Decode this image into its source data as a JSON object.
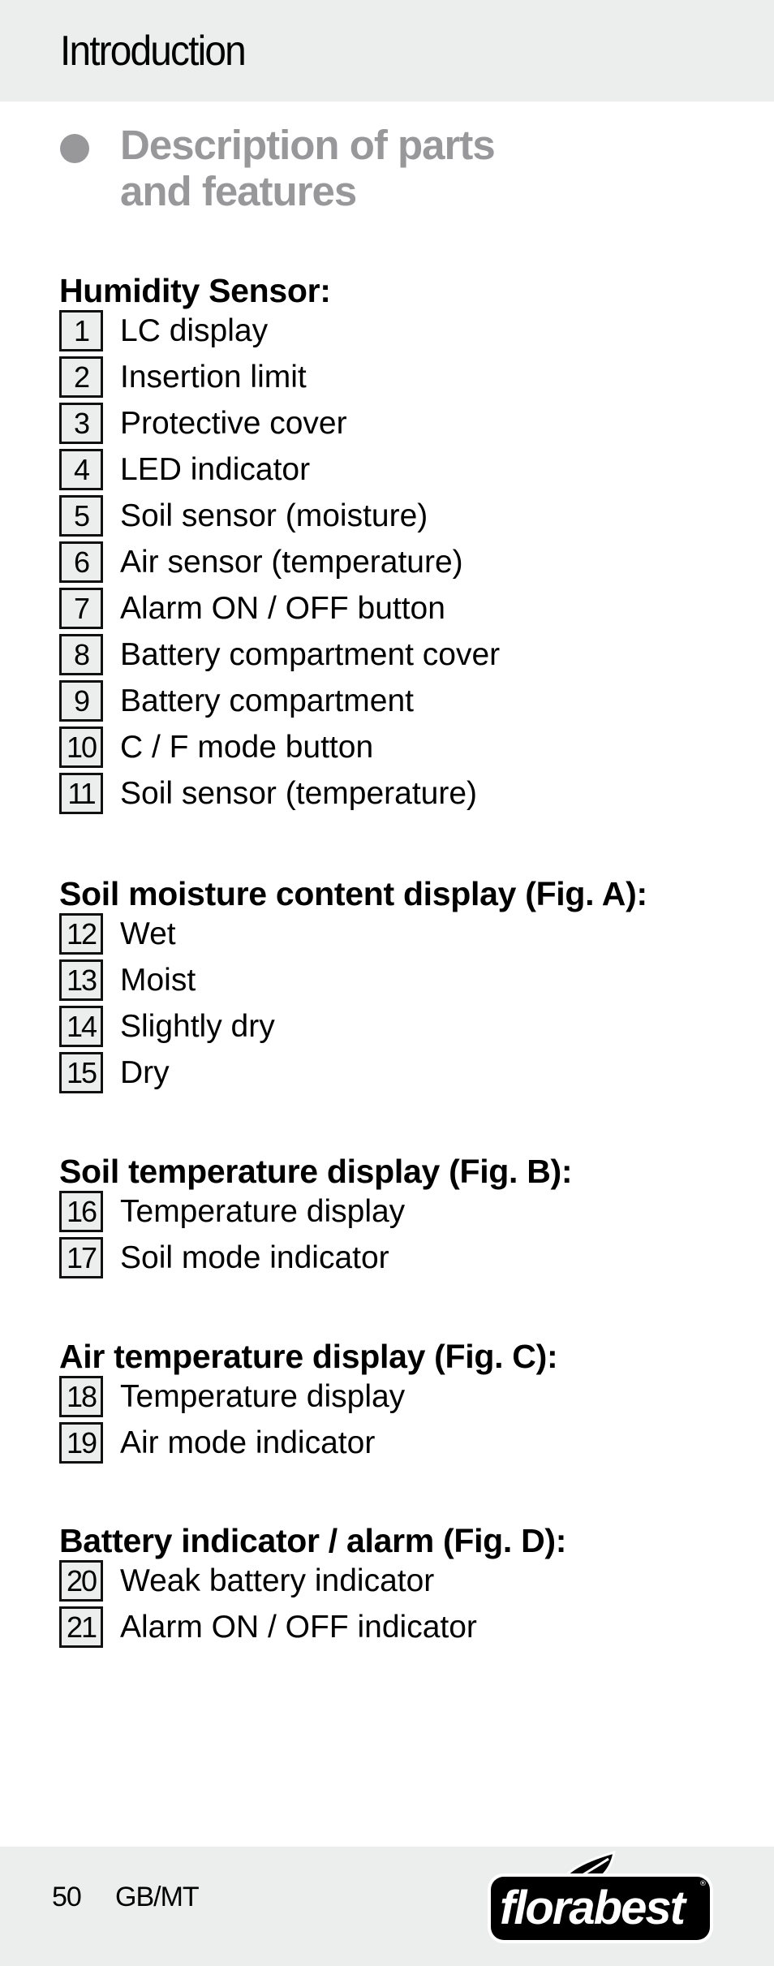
{
  "header": {
    "title": "Introduction"
  },
  "section": {
    "title_line1": "Description of parts",
    "title_line2": "and features"
  },
  "groups": [
    {
      "title": "Humidity Sensor:",
      "items": [
        {
          "num": "1",
          "label": "LC display"
        },
        {
          "num": "2",
          "label": "Insertion limit"
        },
        {
          "num": "3",
          "label": "Protective cover"
        },
        {
          "num": "4",
          "label": "LED indicator"
        },
        {
          "num": "5",
          "label": "Soil sensor (moisture)"
        },
        {
          "num": "6",
          "label": "Air sensor (temperature)"
        },
        {
          "num": "7",
          "label": "Alarm ON / OFF button"
        },
        {
          "num": "8",
          "label": "Battery compartment cover"
        },
        {
          "num": "9",
          "label": "Battery compartment"
        },
        {
          "num": "10",
          "label": "C / F mode button"
        },
        {
          "num": "11",
          "label": "Soil sensor (temperature)"
        }
      ]
    },
    {
      "title": "Soil moisture content display (Fig. A):",
      "items": [
        {
          "num": "12",
          "label": "Wet"
        },
        {
          "num": "13",
          "label": "Moist"
        },
        {
          "num": "14",
          "label": "Slightly dry"
        },
        {
          "num": "15",
          "label": "Dry"
        }
      ]
    },
    {
      "title": "Soil temperature display (Fig. B):",
      "items": [
        {
          "num": "16",
          "label": "Temperature display"
        },
        {
          "num": "17",
          "label": "Soil mode indicator"
        }
      ]
    },
    {
      "title": "Air temperature display (Fig. C):",
      "items": [
        {
          "num": "18",
          "label": "Temperature display"
        },
        {
          "num": "19",
          "label": "Air mode indicator"
        }
      ]
    },
    {
      "title": "Battery indicator / alarm (Fig. D):",
      "items": [
        {
          "num": "20",
          "label": "Weak battery indicator"
        },
        {
          "num": "21",
          "label": "Alarm ON / OFF indicator"
        }
      ]
    }
  ],
  "footer": {
    "page_number": "50",
    "language": "GB/MT",
    "brand": "florabest",
    "registered_mark": "®"
  },
  "colors": {
    "band_gray": "#eceeed",
    "heading_gray": "#98989b"
  }
}
